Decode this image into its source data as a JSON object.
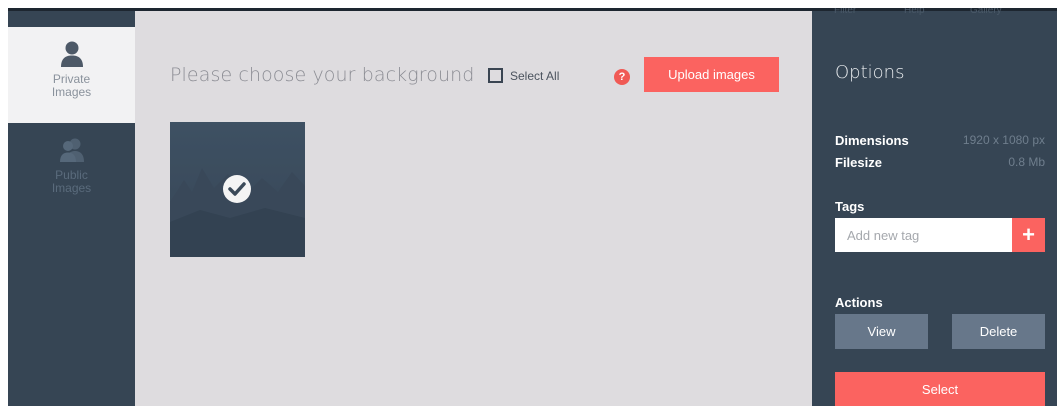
{
  "sidebar": {
    "tabs": [
      {
        "label": "Private\nImages",
        "icon": "user-icon",
        "active": true
      },
      {
        "label": "Public\nImages",
        "icon": "users-icon",
        "active": false
      }
    ]
  },
  "main": {
    "title": "Please choose your background",
    "select_all_label": "Select All",
    "help_glyph": "?",
    "upload_label": "Upload images",
    "images": [
      {
        "selected": true,
        "icon": "check-icon"
      }
    ]
  },
  "options": {
    "ghost_items": [
      "Filter",
      "Help",
      "Gallery"
    ],
    "title": "Options",
    "dimensions_label": "Dimensions",
    "dimensions_value": "1920 x 1080 px",
    "filesize_label": "Filesize",
    "filesize_value": "0.8 Mb",
    "tags_label": "Tags",
    "tag_placeholder": "Add new tag",
    "tag_add_glyph": "+",
    "actions_label": "Actions",
    "view_label": "View",
    "delete_label": "Delete",
    "select_label": "Select"
  },
  "colors": {
    "accent": "#fb6360",
    "panel": "#364554",
    "main_bg": "#dedcdf",
    "tab_active": "#f2f2f3",
    "button_gray": "#67778a"
  }
}
